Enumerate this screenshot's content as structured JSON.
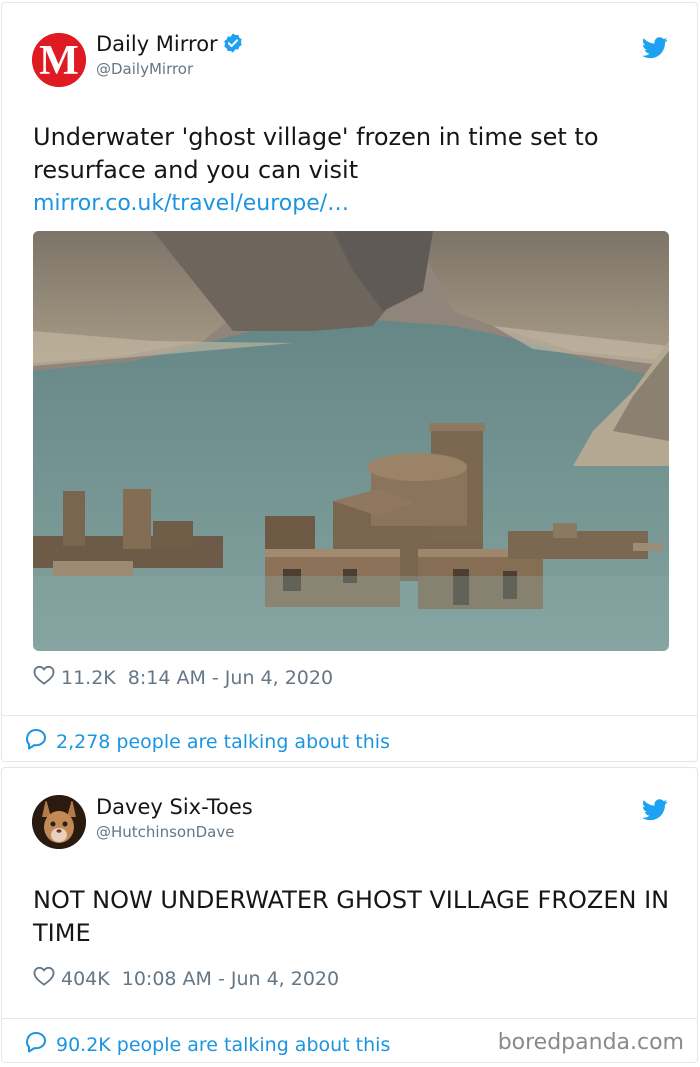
{
  "tweets": [
    {
      "display_name": "Daily Mirror",
      "handle": "@DailyMirror",
      "verified": true,
      "avatar_letter": "M",
      "text": "Underwater 'ghost village' frozen in time set to resurface and you can visit",
      "link": "mirror.co.uk/travel/europe/…",
      "likes": "11.2K",
      "timestamp": "8:14 AM - Jun 4, 2020",
      "talking": "2,278 people are talking about this"
    },
    {
      "display_name": "Davey Six-Toes",
      "handle": "@HutchinsonDave",
      "verified": false,
      "text": "NOT NOW UNDERWATER GHOST VILLAGE FROZEN IN TIME",
      "likes": "404K",
      "timestamp": "10:08 AM - Jun 4, 2020",
      "talking": "90.2K people are talking about this"
    }
  ],
  "watermark": "boredpanda.com",
  "colors": {
    "twitter_blue": "#1da1f2",
    "link_blue": "#1b95e0",
    "mirror_red": "#e01a22",
    "muted_gray": "#657786"
  },
  "icons": {
    "bird": "twitter-bird-icon",
    "verified": "verified-badge-icon",
    "heart": "heart-icon",
    "bubble": "speech-bubble-icon"
  }
}
